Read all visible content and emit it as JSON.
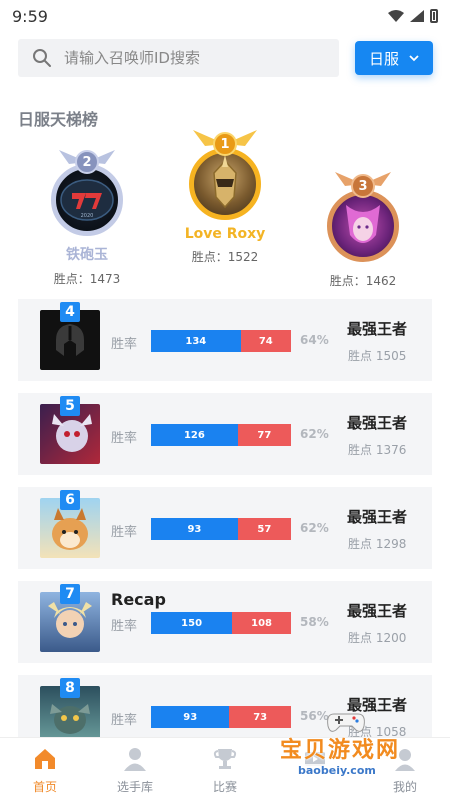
{
  "status_bar": {
    "time": "9:59"
  },
  "search": {
    "placeholder": "请输入召唤师ID搜索"
  },
  "server_select": {
    "label": "日服"
  },
  "section_title": "日服天梯榜",
  "podium": [
    {
      "rank": "2",
      "name": "铁砲玉",
      "points_label": "胜点：1473"
    },
    {
      "rank": "1",
      "name": "Love Roxy",
      "points_label": "胜点：1522"
    },
    {
      "rank": "3",
      "name": "",
      "points_label": "胜点：1462"
    }
  ],
  "list_common": {
    "winrate_label": "胜率"
  },
  "list": [
    {
      "rank": "4",
      "name": "",
      "wins": "134",
      "losses": "74",
      "win_fraction": 0.64,
      "pct": "64%",
      "tier": "最强王者",
      "points": "胜点 1505"
    },
    {
      "rank": "5",
      "name": "",
      "wins": "126",
      "losses": "77",
      "win_fraction": 0.62,
      "pct": "62%",
      "tier": "最强王者",
      "points": "胜点 1376"
    },
    {
      "rank": "6",
      "name": "",
      "wins": "93",
      "losses": "57",
      "win_fraction": 0.62,
      "pct": "62%",
      "tier": "最强王者",
      "points": "胜点 1298"
    },
    {
      "rank": "7",
      "name": "Recap",
      "wins": "150",
      "losses": "108",
      "win_fraction": 0.58,
      "pct": "58%",
      "tier": "最强王者",
      "points": "胜点 1200"
    },
    {
      "rank": "8",
      "name": "",
      "wins": "93",
      "losses": "73",
      "win_fraction": 0.56,
      "pct": "56%",
      "tier": "最强王者",
      "points": "胜点 1058"
    }
  ],
  "tabbar": [
    {
      "label": "首页",
      "icon": "home-icon",
      "active": true
    },
    {
      "label": "选手库",
      "icon": "person-icon",
      "active": false
    },
    {
      "label": "比赛",
      "icon": "trophy-icon",
      "active": false
    },
    {
      "label": "",
      "icon": "video-icon",
      "active": false
    },
    {
      "label": "我的",
      "icon": "profile-icon",
      "active": false
    }
  ],
  "watermark": {
    "text": "宝贝游戏网",
    "url": "baobeiy.com"
  },
  "colors": {
    "accent": "#1687f2",
    "win": "#1a82f0",
    "loss": "#ed5a5a",
    "gold": "#f6b321",
    "silver": "#aab4d6",
    "bronze": "#d9874a",
    "tab_active": "#f08a2a"
  }
}
